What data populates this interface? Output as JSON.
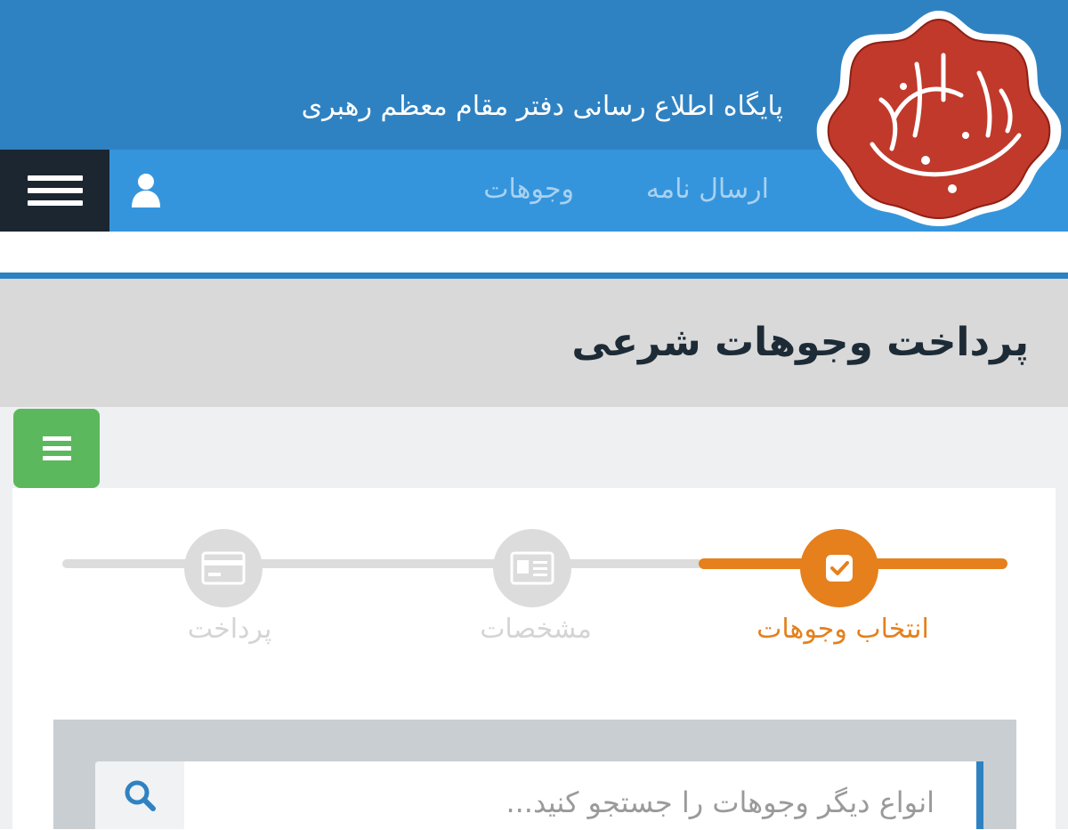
{
  "header": {
    "site_title": "پایگاه اطلاع رسانی دفتر مقام معظم رهبری",
    "logo_text": "سید علی خامنه ای",
    "background": "#2f82c2"
  },
  "nav": {
    "links": [
      {
        "label": "ارسال نامه"
      },
      {
        "label": "وجوهات"
      }
    ],
    "background": "#3595dc",
    "menu_icon": "hamburger-icon",
    "user_icon": "user-icon"
  },
  "page": {
    "title": "پرداخت وجوهات شرعی"
  },
  "sidebar_toggle": {
    "icon": "hamburger-icon",
    "color": "#5cb85c"
  },
  "steps": [
    {
      "label": "انتخاب وجوهات",
      "icon": "checkbox-icon",
      "state": "active"
    },
    {
      "label": "مشخصات",
      "icon": "id-card-icon",
      "state": "pending"
    },
    {
      "label": "پرداخت",
      "icon": "credit-card-icon",
      "state": "pending"
    }
  ],
  "search": {
    "placeholder": "انواع دیگر وجوهات را جستجو کنید...",
    "value": "",
    "icon": "search-icon"
  },
  "colors": {
    "accent_orange": "#e5801c",
    "step_inactive": "#dcdcdc",
    "primary_blue": "#2f82c2"
  }
}
